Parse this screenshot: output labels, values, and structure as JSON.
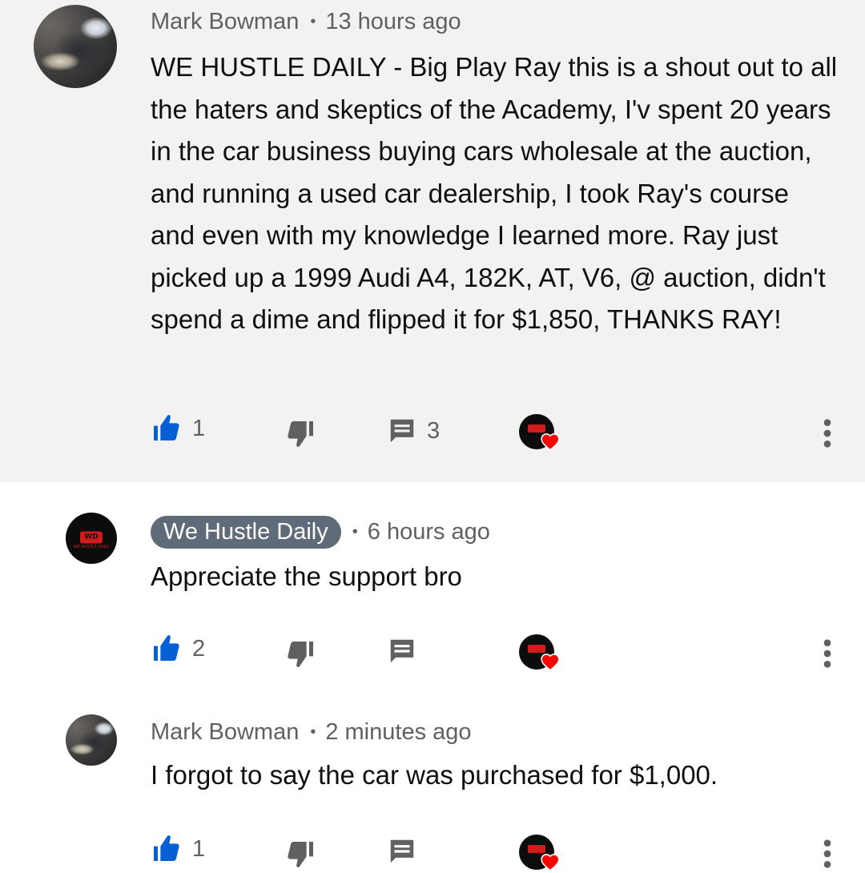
{
  "comments": [
    {
      "author": "Mark Bowman",
      "time": "13 hours ago",
      "text": "WE HUSTLE DAILY - Big Play Ray this is a shout out to all the haters and skeptics of the Academy, I'v spent 20 years in the car business buying cars wholesale at the auction, and running a used car dealership, I took Ray's course and even with my knowledge I learned more. Ray just picked up a 1999 Audi A4, 182K, AT, V6, @ auction, didn't spend a dime and flipped it for $1,850, THANKS RAY!",
      "likes": "1",
      "replies": "3",
      "avatar_icon": "user-photo-icon",
      "highlighted": true
    },
    {
      "author": "We Hustle Daily",
      "time": "6 hours ago",
      "text": "Appreciate the support bro",
      "likes": "2",
      "avatar_icon": "channel-logo-icon",
      "author_is_creator": true
    },
    {
      "author": "Mark Bowman",
      "time": "2 minutes ago",
      "text": "I forgot to say the car was purchased for $1,000.",
      "likes": "1",
      "avatar_icon": "user-photo-icon"
    }
  ],
  "logo_text": "WE HUSTLE DAILY",
  "logo_initials": "WD",
  "separator": "•",
  "colors": {
    "like_blue": "#065fd4",
    "heart_red": "#ff0000",
    "creator_chip": "#5f6b78",
    "secondary_text": "#606060",
    "highlight_bg": "#f2f2f2"
  }
}
